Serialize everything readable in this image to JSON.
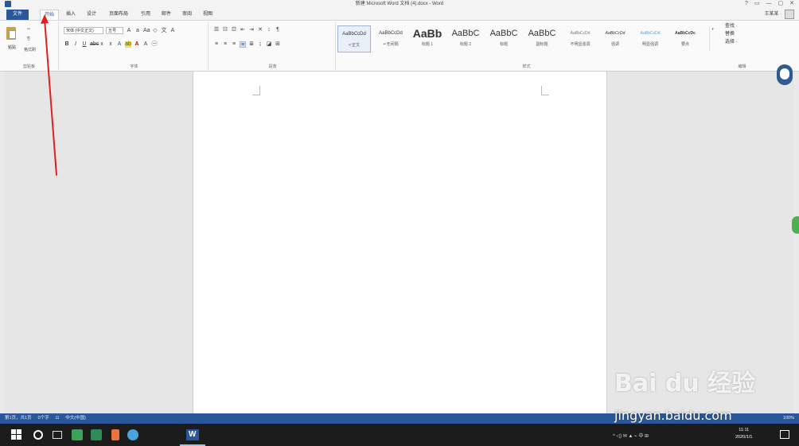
{
  "window": {
    "title": "新建 Microsoft Word 文档 (4).docx - Word",
    "controls": [
      "?",
      "▭",
      "—",
      "▢",
      "✕"
    ],
    "user": "王某某 ·"
  },
  "tabs": [
    "文件",
    "开始",
    "插入",
    "设计",
    "页面布局",
    "引用",
    "邮件",
    "审阅",
    "视图"
  ],
  "ribbon": {
    "clipboard": {
      "paste": "粘贴",
      "cut": "✂",
      "copy": "⎘",
      "format_painter": "格式刷",
      "label": "剪贴板"
    },
    "font": {
      "name": "宋体 (中文正文)",
      "size": "五号",
      "label": "字体"
    },
    "paragraph": {
      "label": "段落"
    },
    "styles": {
      "label": "样式",
      "items": [
        {
          "sample": "AaBbCcDd",
          "name": "↵正文"
        },
        {
          "sample": "AaBbCcDd",
          "name": "↵无间隔"
        },
        {
          "sample": "AaBb",
          "name": "标题 1"
        },
        {
          "sample": "AaBbC",
          "name": "标题 2"
        },
        {
          "sample": "AaBbC",
          "name": "标题"
        },
        {
          "sample": "AaBbC",
          "name": "副标题"
        },
        {
          "sample": "AaBbCcDd",
          "name": "不明显强调"
        },
        {
          "sample": "AaBbCcDd",
          "name": "强调"
        },
        {
          "sample": "AaBbCcDd",
          "name": "明显强调"
        },
        {
          "sample": "AaBbCcDc",
          "name": "要点"
        }
      ]
    },
    "editing": {
      "find": "查找 ·",
      "replace": "替换",
      "select": "选择 ·",
      "label": "编辑"
    }
  },
  "statusbar": {
    "page": "第1页，共1页",
    "words": "0个字",
    "lang": "中文(中国)",
    "zoom": "100%"
  },
  "taskbar": {
    "tray_text": "^ ◁) ✉ ▲ ⌁ 中 ⊞",
    "time": "11:11",
    "date": "2020/1/1"
  },
  "watermark": {
    "logo": "Bai du 经验",
    "url": "jingyan.baidu.com"
  },
  "colors": {
    "accent": "#2b579a",
    "annotation_arrow": "#e02020"
  }
}
